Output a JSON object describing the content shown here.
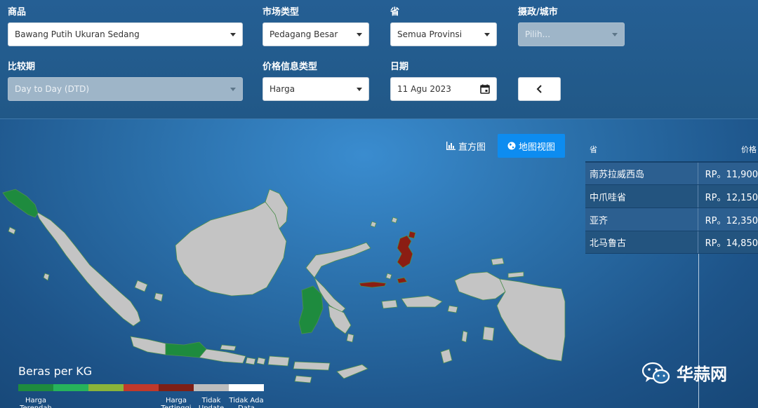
{
  "filters": {
    "commodity": {
      "label": "商品",
      "value": "Bawang Putih Ukuran Sedang"
    },
    "market_type": {
      "label": "市场类型",
      "value": "Pedagang Besar"
    },
    "province": {
      "label": "省",
      "value": "Semua Provinsi"
    },
    "regency": {
      "label": "摄政/城市",
      "placeholder": "Pilih..."
    },
    "comparison": {
      "label": "比较期",
      "value": "Day to Day (DTD)"
    },
    "price_info_type": {
      "label": "价格信息类型",
      "value": "Harga"
    },
    "date": {
      "label": "日期",
      "value": "11 Agu 2023"
    }
  },
  "view_toggle": {
    "histogram_label": "直方图",
    "histogram_icon": "bar-chart-icon",
    "map_label": "地图视图",
    "map_icon": "globe-icon"
  },
  "legend": {
    "title": "Beras per KG",
    "items": [
      {
        "label": "Harga Terendah",
        "color": "#1e8b3e"
      },
      {
        "label": "",
        "color": "#27b35b"
      },
      {
        "label": "",
        "color": "#8ab43a"
      },
      {
        "label": "",
        "color": "#c0392b"
      },
      {
        "label": "Harga Tertinggi",
        "color": "#7d1f16"
      },
      {
        "label": "Tidak Update",
        "color": "#bdbdbd"
      },
      {
        "label": "Tidak Ada Data",
        "color": "#ffffff"
      }
    ]
  },
  "table": {
    "col_province": "省",
    "col_price": "价格",
    "rows": [
      {
        "province": "南苏拉威西岛",
        "price": "RP。11,900"
      },
      {
        "province": "中爪哇省",
        "price": "RP。12,150"
      },
      {
        "province": "亚齐",
        "price": "RP。12,350"
      },
      {
        "province": "北马鲁古",
        "price": "RP。14,850"
      }
    ]
  },
  "watermark": {
    "text": "华蒜网",
    "icon": "wechat-icon"
  },
  "colors": {
    "map_default": "#c4c4c4",
    "map_low": "#1e8b3e",
    "map_high": "#8b1d13",
    "active_button": "#0d8cf0"
  }
}
